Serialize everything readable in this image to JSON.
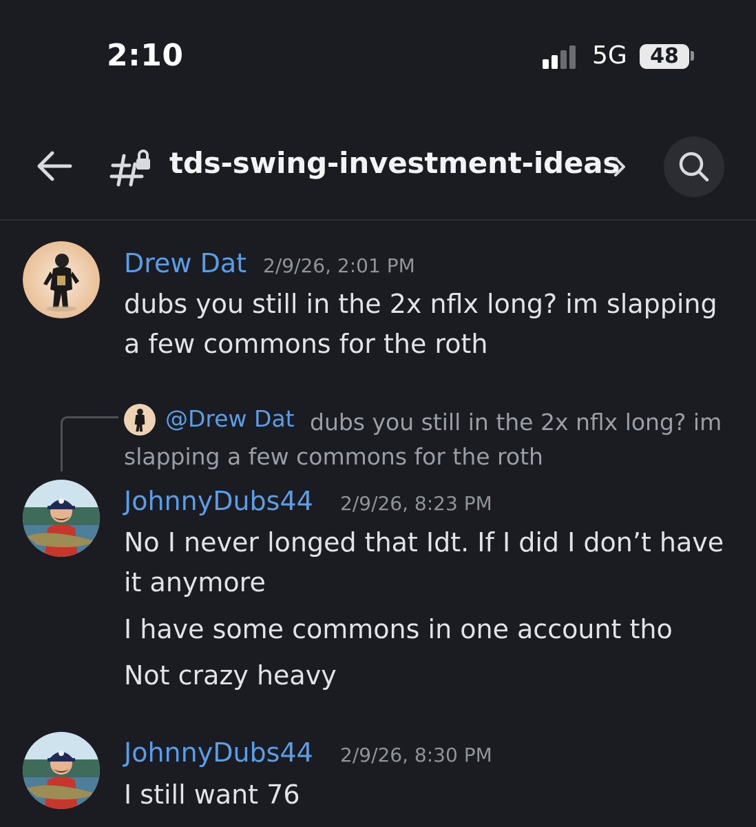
{
  "status_bar": {
    "time": "2:10",
    "network": "5G",
    "battery": "48"
  },
  "header": {
    "channel_name": "tds-swing-investment-ideas",
    "channel_icon": "hashtag-lock-icon"
  },
  "colors": {
    "background": "#1b1c21",
    "author_name": "#5a9ee8",
    "message_text": "#e2e3e6",
    "timestamp": "#8f949b"
  },
  "messages": [
    {
      "author": "Drew Dat",
      "timestamp": "2/9/26, 2:01 PM",
      "lines": [
        "dubs you still in the 2x nflx long? im slapping a few commons for the roth"
      ]
    },
    {
      "reply_to": {
        "mention": "@Drew Dat",
        "text": "dubs you still in the 2x nflx long? im slapping a few commons for the roth"
      },
      "author": "JohnnyDubs44",
      "timestamp": "2/9/26, 8:23 PM",
      "lines": [
        "No I never longed that Idt. If I did I don’t have it anymore",
        "I have some commons in one account tho",
        "Not crazy heavy"
      ]
    },
    {
      "author": "JohnnyDubs44",
      "timestamp": "2/9/26, 8:30 PM",
      "lines": [
        "I still want 76"
      ]
    }
  ]
}
